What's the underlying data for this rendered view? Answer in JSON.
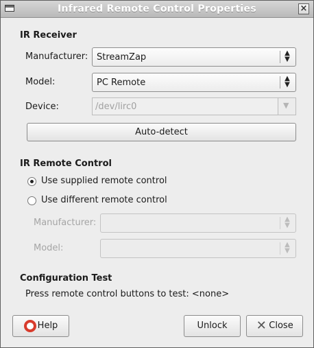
{
  "window": {
    "title": "Infrared Remote Control Properties"
  },
  "ir_receiver": {
    "heading": "IR Receiver",
    "manufacturer_label": "Manufacturer:",
    "manufacturer_value": "StreamZap",
    "model_label": "Model:",
    "model_value": "PC Remote",
    "device_label": "Device:",
    "device_value": "/dev/lirc0",
    "autodetect_label": "Auto-detect"
  },
  "ir_remote": {
    "heading": "IR Remote Control",
    "option_supplied": "Use supplied remote control",
    "option_different": "Use different remote control",
    "manufacturer_label": "Manufacturer:",
    "model_label": "Model:"
  },
  "config_test": {
    "heading": "Configuration Test",
    "status_text": "Press remote control buttons to test: <none>"
  },
  "buttons": {
    "help": "Help",
    "unlock": "Unlock",
    "close": "Close"
  }
}
